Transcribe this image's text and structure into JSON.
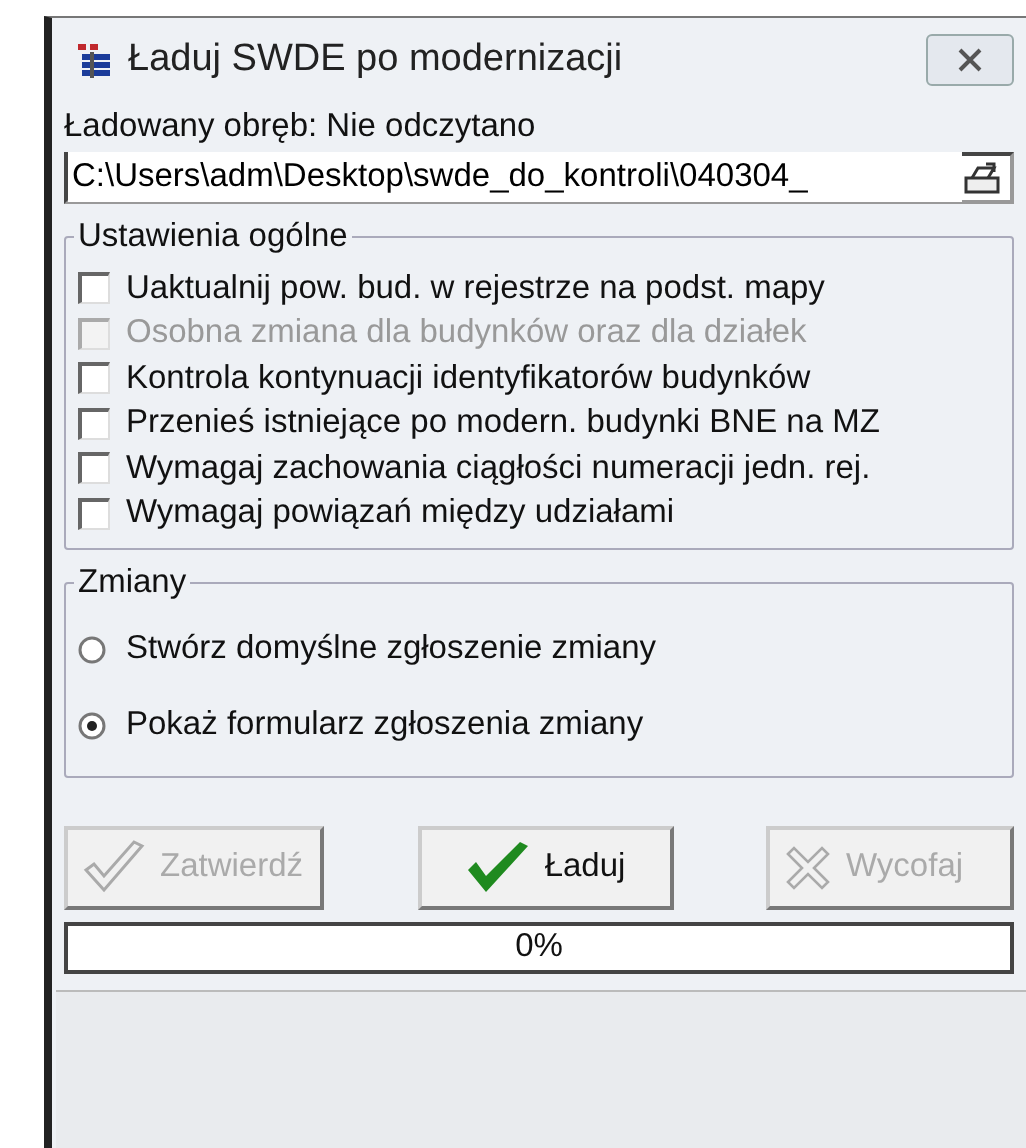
{
  "window": {
    "title": "Ładuj SWDE po modernizacji"
  },
  "parcel_label": "Ładowany obręb: Nie odczytano",
  "path_field": {
    "value": "C:\\Users\\adm\\Desktop\\swde_do_kontroli\\040304_"
  },
  "general_settings": {
    "title": "Ustawienia ogólne",
    "options": [
      {
        "label": "Uaktualnij pow. bud. w rejestrze na podst. mapy",
        "checked": false,
        "disabled": false
      },
      {
        "label": "Osobna zmiana dla budynków oraz dla działek",
        "checked": false,
        "disabled": true
      },
      {
        "label": "Kontrola kontynuacji identyfikatorów budynków",
        "checked": false,
        "disabled": false
      },
      {
        "label": "Przenieś istniejące po modern. budynki BNE na MZ",
        "checked": false,
        "disabled": false
      },
      {
        "label": "Wymagaj zachowania ciągłości numeracji jedn. rej.",
        "checked": false,
        "disabled": false
      },
      {
        "label": "Wymagaj powiązań między udziałami",
        "checked": false,
        "disabled": false
      }
    ]
  },
  "changes": {
    "title": "Zmiany",
    "options": [
      {
        "label": "Stwórz domyślne zgłoszenie zmiany",
        "selected": false
      },
      {
        "label": "Pokaż formularz zgłoszenia zmiany",
        "selected": true
      }
    ]
  },
  "buttons": [
    {
      "label": "Zatwierdź",
      "kind": "confirm",
      "disabled": true
    },
    {
      "label": "Ładuj",
      "kind": "load",
      "disabled": false
    },
    {
      "label": "Wycofaj",
      "kind": "cancel",
      "disabled": true
    }
  ],
  "progress": {
    "level": 0,
    "reading": "0%"
  }
}
